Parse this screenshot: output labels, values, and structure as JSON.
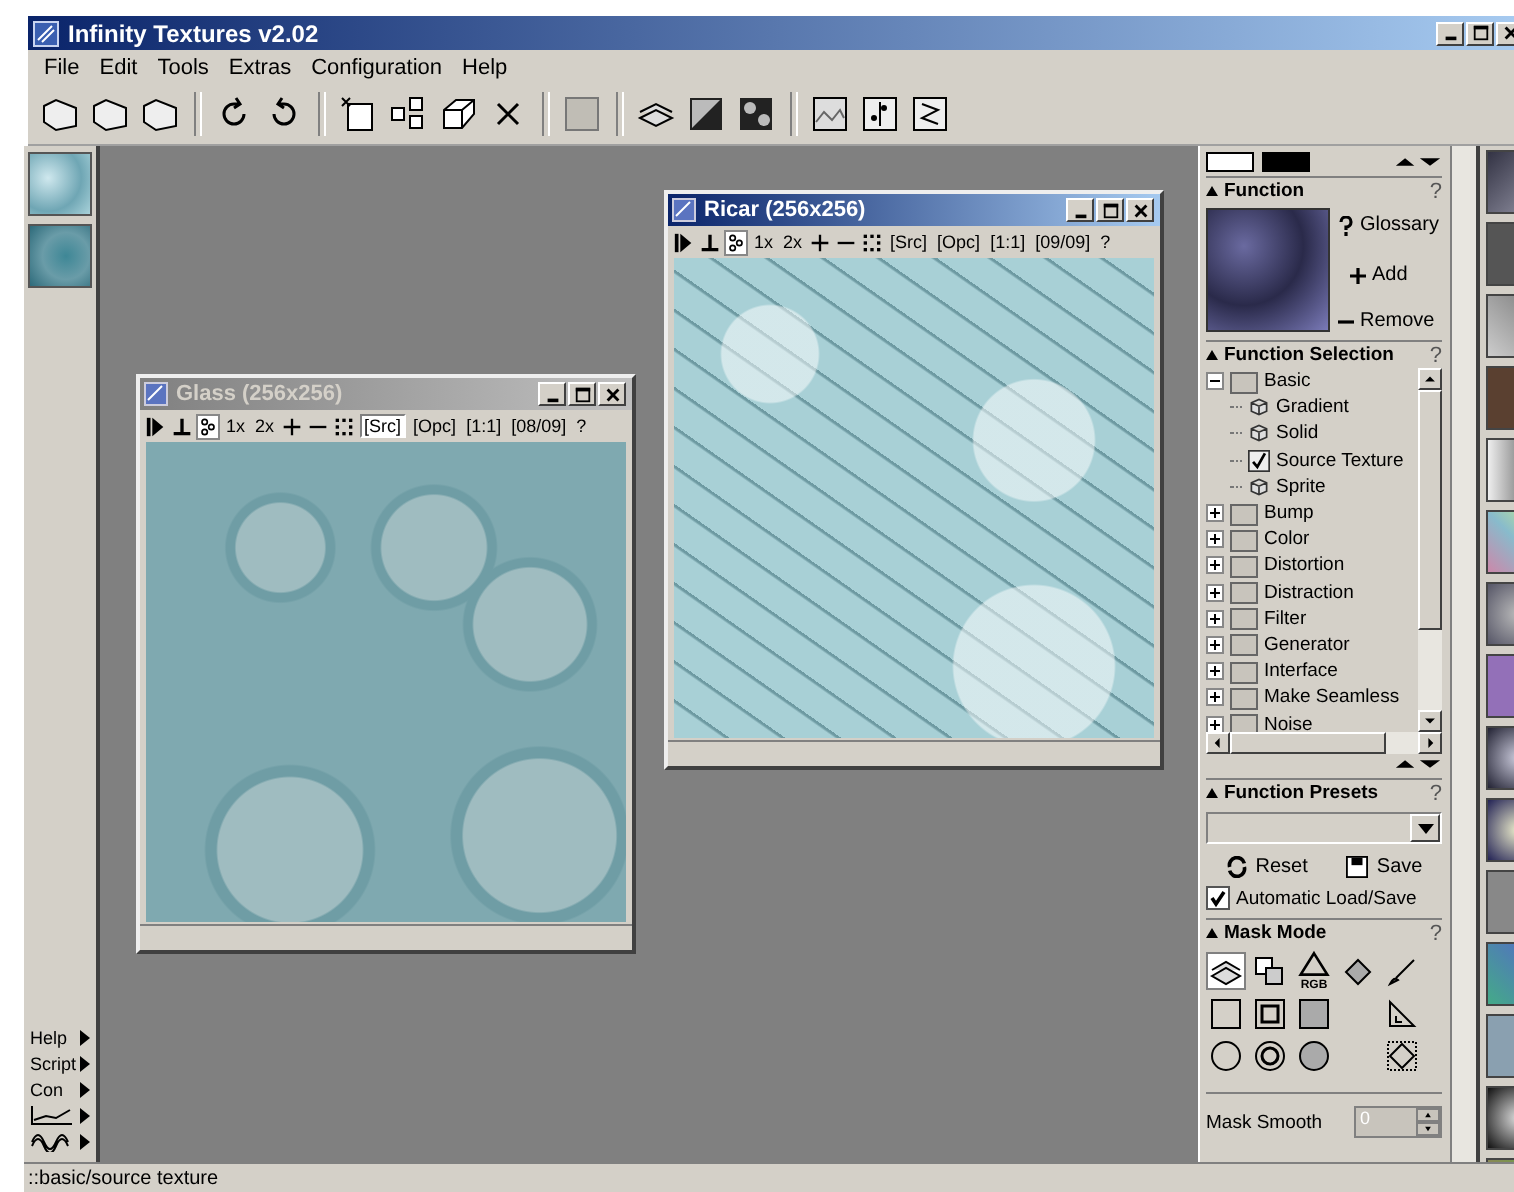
{
  "window": {
    "title": "Infinity Textures v2.02"
  },
  "menu": [
    "File",
    "Edit",
    "Tools",
    "Extras",
    "Configuration",
    "Help"
  ],
  "side_menu": [
    {
      "kind": "text",
      "label": "Help"
    },
    {
      "kind": "text",
      "label": "Script"
    },
    {
      "kind": "text",
      "label": "Con"
    },
    {
      "kind": "graph"
    },
    {
      "kind": "wave"
    }
  ],
  "documents": [
    {
      "title": "Glass (256x256)",
      "active": false,
      "tools": [
        {
          "kind": "text",
          "label": "1x",
          "selected": false
        },
        {
          "kind": "text",
          "label": "2x",
          "selected": false
        },
        {
          "kind": "plus"
        },
        {
          "kind": "minus"
        },
        {
          "kind": "grid"
        },
        {
          "kind": "text",
          "label": "[Src]",
          "selected": true
        },
        {
          "kind": "text",
          "label": "[Opc]",
          "selected": false
        },
        {
          "kind": "text",
          "label": "[1:1]",
          "selected": false
        },
        {
          "kind": "text",
          "label": "[08/09]",
          "selected": false
        },
        {
          "kind": "text",
          "label": "?",
          "selected": false
        }
      ]
    },
    {
      "title": "Ricar (256x256)",
      "active": true,
      "tools": [
        {
          "kind": "text",
          "label": "1x",
          "selected": false
        },
        {
          "kind": "text",
          "label": "2x",
          "selected": false
        },
        {
          "kind": "plus"
        },
        {
          "kind": "minus"
        },
        {
          "kind": "grid"
        },
        {
          "kind": "text",
          "label": "[Src]",
          "selected": false
        },
        {
          "kind": "text",
          "label": "[Opc]",
          "selected": false
        },
        {
          "kind": "text",
          "label": "[1:1]",
          "selected": false
        },
        {
          "kind": "text",
          "label": "[09/09]",
          "selected": false
        },
        {
          "kind": "text",
          "label": "?",
          "selected": false
        }
      ]
    }
  ],
  "function": {
    "title": "Function",
    "help": "?",
    "actions": [
      {
        "kind": "glossary",
        "label": "Glossary"
      },
      {
        "kind": "add",
        "label": "Add"
      },
      {
        "kind": "remove",
        "label": "Remove"
      }
    ]
  },
  "function_selection": {
    "title": "Function Selection",
    "help": "?",
    "tree": [
      {
        "label": "Basic",
        "expanded": true,
        "children": [
          {
            "label": "Gradient",
            "checked": false
          },
          {
            "label": "Solid",
            "checked": false
          },
          {
            "label": "Source Texture",
            "checked": true
          },
          {
            "label": "Sprite",
            "checked": false
          }
        ]
      },
      {
        "label": "Bump",
        "expanded": false
      },
      {
        "label": "Color",
        "expanded": false
      },
      {
        "label": "Distortion",
        "expanded": false
      },
      {
        "label": "Distraction",
        "expanded": false
      },
      {
        "label": "Filter",
        "expanded": false
      },
      {
        "label": "Generator",
        "expanded": false
      },
      {
        "label": "Interface",
        "expanded": false
      },
      {
        "label": "Make Seamless",
        "expanded": false
      },
      {
        "label": "Noise",
        "expanded": false
      }
    ]
  },
  "function_presets": {
    "title": "Function Presets",
    "help": "?",
    "buttons": [
      {
        "kind": "reset",
        "label": "Reset"
      },
      {
        "kind": "save",
        "label": "Save"
      }
    ],
    "auto": {
      "label": "Automatic Load/Save",
      "checked": true
    }
  },
  "mask_mode": {
    "title": "Mask Mode",
    "help": "?",
    "tools": [
      {
        "kind": "layer",
        "selected": true
      },
      {
        "kind": "copy",
        "selected": false
      },
      {
        "kind": "rgb",
        "label": "RGB",
        "selected": false
      },
      {
        "kind": "fill",
        "selected": false
      },
      {
        "kind": "brush",
        "selected": false
      },
      {
        "kind": "square",
        "selected": false
      },
      {
        "kind": "square-frame",
        "selected": false
      },
      {
        "kind": "square-soft",
        "selected": false
      },
      {
        "kind": "gap"
      },
      {
        "kind": "ruler",
        "selected": false
      },
      {
        "kind": "circle",
        "selected": false
      },
      {
        "kind": "circle-frame",
        "selected": false
      },
      {
        "kind": "circle-soft",
        "selected": false
      },
      {
        "kind": "gap"
      },
      {
        "kind": "diamond",
        "selected": false
      }
    ],
    "smooth": {
      "label": "Mask Smooth",
      "value": "0"
    }
  },
  "status_bar": "::basic/source texture"
}
